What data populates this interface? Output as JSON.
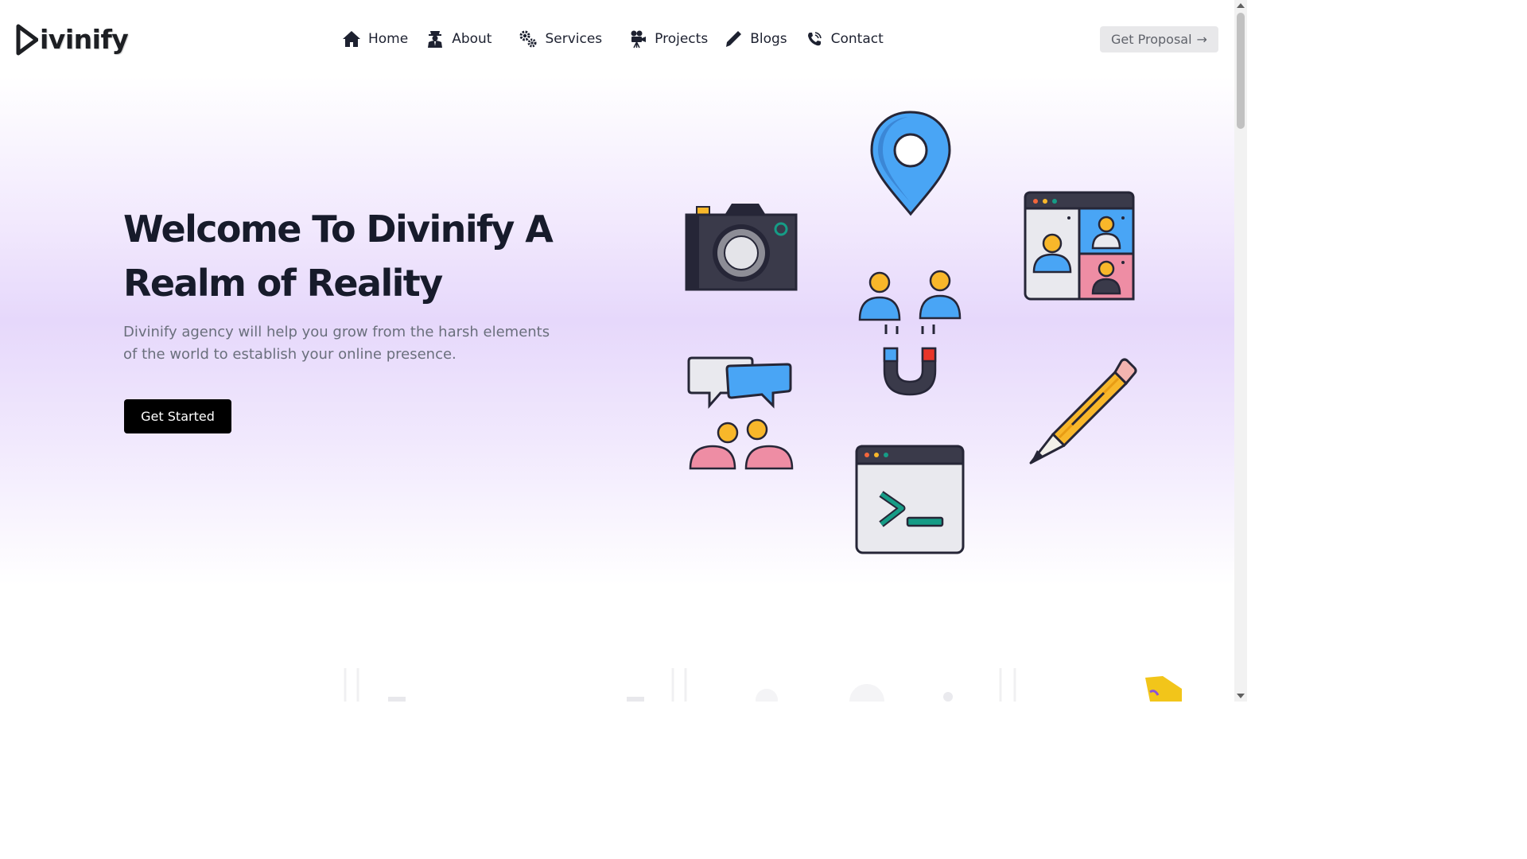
{
  "brand": {
    "name": "ivinify",
    "logo_icon": "play-triangle-d-icon"
  },
  "nav": {
    "items": [
      {
        "label": "Home",
        "icon": "home-icon"
      },
      {
        "label": "About",
        "icon": "agent-icon"
      },
      {
        "label": "Services",
        "icon": "gears-icon"
      },
      {
        "label": "Projects",
        "icon": "video-camera-icon"
      },
      {
        "label": "Blogs",
        "icon": "pen-icon"
      },
      {
        "label": "Contact",
        "icon": "phone-icon"
      }
    ],
    "proposal_label": "Get Proposal",
    "proposal_arrow": "→"
  },
  "hero": {
    "title_line1": "Welcome To Divinify A",
    "title_line2": "Realm of Reality",
    "subtitle": "Divinify agency will help you grow from the harsh elements of the world to establish your online presence.",
    "cta_label": "Get Started"
  },
  "illustrations": [
    "camera-icon",
    "location-pin-icon",
    "video-call-icon",
    "customer-magnet-icon",
    "chat-users-icon",
    "pencil-icon",
    "terminal-icon"
  ],
  "colors": {
    "hero_gradient_mid": "#e6d8fb",
    "cta_bg": "#000000",
    "accent_blue": "#49a5f5",
    "accent_yellow": "#f8b72a",
    "accent_pink": "#ee8da4",
    "accent_teal": "#169c86",
    "outline": "#262637"
  }
}
